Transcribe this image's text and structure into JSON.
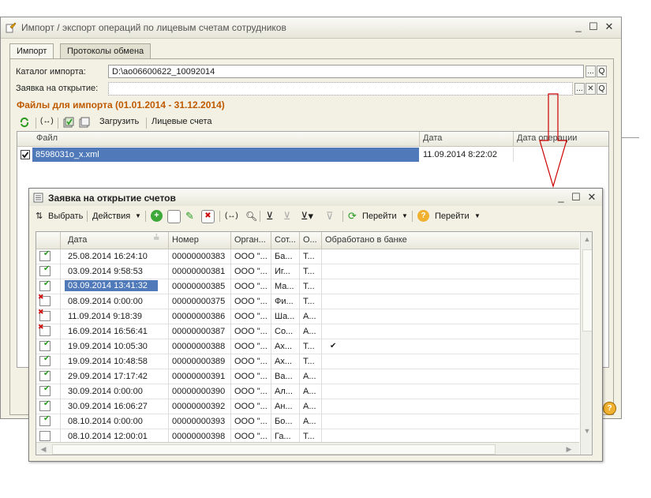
{
  "main_window": {
    "title": "Импорт / экспорт операций по лицевым счетам сотрудников",
    "controls": {
      "minimize": "_",
      "maximize": "☐",
      "close": "✕"
    }
  },
  "tabs": [
    {
      "label": "Импорт",
      "active": true
    },
    {
      "label": "Протоколы обмена",
      "active": false
    }
  ],
  "import_catalog": {
    "label": "Каталог импорта:",
    "value": "D:\\ao06600622_10092014",
    "select_label": "...",
    "search_label": "Q"
  },
  "request_field": {
    "label": "Заявка на открытие:",
    "value": "",
    "select_label": "...",
    "clear_label": "✕",
    "search_label": "Q"
  },
  "files_section": {
    "title": "Файлы для импорта  (01.01.2014 - 31.12.2014)"
  },
  "files_toolbar": {
    "load_label": "Загрузить",
    "accounts_label": "Лицевые счета"
  },
  "files_grid": {
    "columns": [
      "Файл",
      "Дата",
      "Дата операции"
    ],
    "rows": [
      {
        "checked": true,
        "file": "8598031o_x.xml",
        "date": "11.09.2014 8:22:02",
        "op_date": ""
      }
    ]
  },
  "dialog": {
    "title": "Заявка на открытие счетов",
    "controls": {
      "minimize": "_",
      "maximize": "☐",
      "close": "✕"
    },
    "toolbar": {
      "select_label": "Выбрать",
      "actions_label": "Действия",
      "goto_label_1": "Перейти",
      "goto_label_2": "Перейти"
    },
    "columns": [
      "Дата",
      "Номер",
      "Орган...",
      "Сот...",
      "О...",
      "Обработано в банке"
    ],
    "rows": [
      {
        "status": "ok",
        "date": "25.08.2014 16:24:10",
        "number": "00000000383",
        "org": "ООО \"...",
        "emp": "Ба...",
        "o": "Т...",
        "processed": ""
      },
      {
        "status": "ok",
        "date": "03.09.2014 9:58:53",
        "number": "00000000381",
        "org": "ООО \"...",
        "emp": "Иг...",
        "o": "Т...",
        "processed": ""
      },
      {
        "status": "ok",
        "date": "03.09.2014 13:41:32",
        "number": "00000000385",
        "org": "ООО \"...",
        "emp": "Ма...",
        "o": "Т...",
        "processed": "",
        "selected": true
      },
      {
        "status": "err",
        "date": "08.09.2014 0:00:00",
        "number": "00000000375",
        "org": "ООО \"...",
        "emp": "Фи...",
        "o": "Т...",
        "processed": ""
      },
      {
        "status": "err",
        "date": "11.09.2014 9:18:39",
        "number": "00000000386",
        "org": "ООО \"...",
        "emp": "Ша...",
        "o": "А...",
        "processed": ""
      },
      {
        "status": "err",
        "date": "16.09.2014 16:56:41",
        "number": "00000000387",
        "org": "ООО \"...",
        "emp": "Со...",
        "o": "А...",
        "processed": ""
      },
      {
        "status": "ok",
        "date": "19.09.2014 10:05:30",
        "number": "00000000388",
        "org": "ООО \"...",
        "emp": "Ах...",
        "o": "Т...",
        "processed": "✔"
      },
      {
        "status": "ok",
        "date": "19.09.2014 10:48:58",
        "number": "00000000389",
        "org": "ООО \"...",
        "emp": "Ах...",
        "o": "Т...",
        "processed": ""
      },
      {
        "status": "ok",
        "date": "29.09.2014 17:17:42",
        "number": "00000000391",
        "org": "ООО \"...",
        "emp": "Ва...",
        "o": "А...",
        "processed": ""
      },
      {
        "status": "ok",
        "date": "30.09.2014 0:00:00",
        "number": "00000000390",
        "org": "ООО \"...",
        "emp": "Ал...",
        "o": "А...",
        "processed": ""
      },
      {
        "status": "ok",
        "date": "30.09.2014 16:06:27",
        "number": "00000000392",
        "org": "ООО \"...",
        "emp": "Ан...",
        "o": "А...",
        "processed": ""
      },
      {
        "status": "ok",
        "date": "08.10.2014 0:00:00",
        "number": "00000000393",
        "org": "ООО \"...",
        "emp": "Бо...",
        "o": "А...",
        "processed": ""
      },
      {
        "status": "doc",
        "date": "08.10.2014 12:00:01",
        "number": "00000000398",
        "org": "ООО \"...",
        "emp": "Га...",
        "o": "Т...",
        "processed": ""
      }
    ]
  },
  "help_icon": "?",
  "colors": {
    "accent_orange": "#c05a00",
    "selection_blue": "#4f79b8",
    "arrow_red": "#cc0000"
  }
}
